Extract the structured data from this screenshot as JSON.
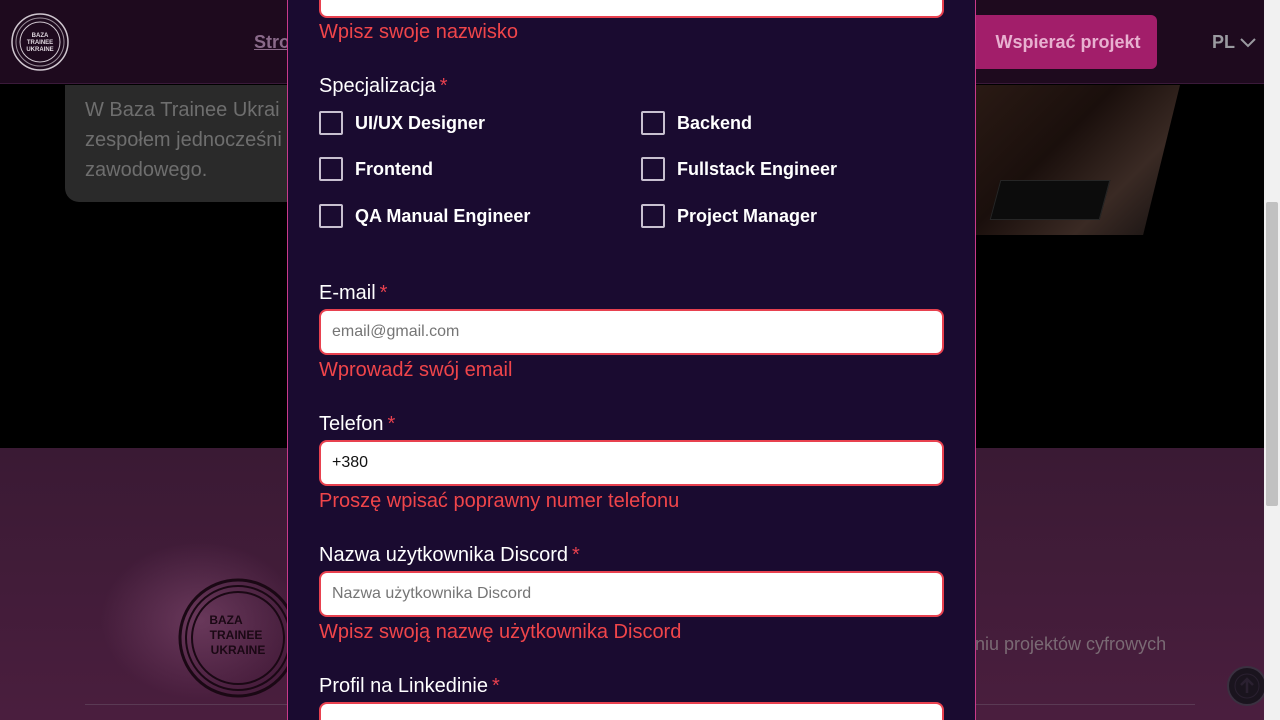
{
  "header": {
    "logo_text": "BAZA TRAINEE UKRAINE",
    "nav_label": "Stro",
    "support_label": "Wspierać projekt",
    "lang_label": "PL"
  },
  "hero": {
    "card_lines": [
      "W Baza Trainee Ukrai",
      "zespołem jednocześni",
      "zawodowego."
    ]
  },
  "footer": {
    "text": "niu projektów cyfrowych"
  },
  "form": {
    "surname_error": "Wpisz swoje nazwisko",
    "specialization": {
      "label": "Specjalizacja",
      "required": "*",
      "options": [
        {
          "label": "UI/UX Designer"
        },
        {
          "label": "Backend"
        },
        {
          "label": "Frontend"
        },
        {
          "label": "Fullstack Engineer"
        },
        {
          "label": "QA Manual Engineer"
        },
        {
          "label": "Project Manager"
        }
      ]
    },
    "email": {
      "label": "E-mail",
      "required": "*",
      "placeholder": "email@gmail.com",
      "error": "Wprowadź swój email"
    },
    "phone": {
      "label": "Telefon",
      "required": "*",
      "value": "+380",
      "error": "Proszę wpisać poprawny numer telefonu"
    },
    "discord": {
      "label": "Nazwa użytkownika Discord",
      "required": "*",
      "placeholder": "Nazwa użytkownika Discord",
      "error": "Wpisz swoją nazwę użytkownika Discord"
    },
    "linkedin": {
      "label": "Profil na Linkedinie",
      "required": "*"
    }
  },
  "colors": {
    "modal_bg": "#1a0b30",
    "error": "#f0454a",
    "accent": "#c93a8a"
  },
  "icons": [
    "logo-icon",
    "chevron-down-icon",
    "arrow-up-icon"
  ]
}
